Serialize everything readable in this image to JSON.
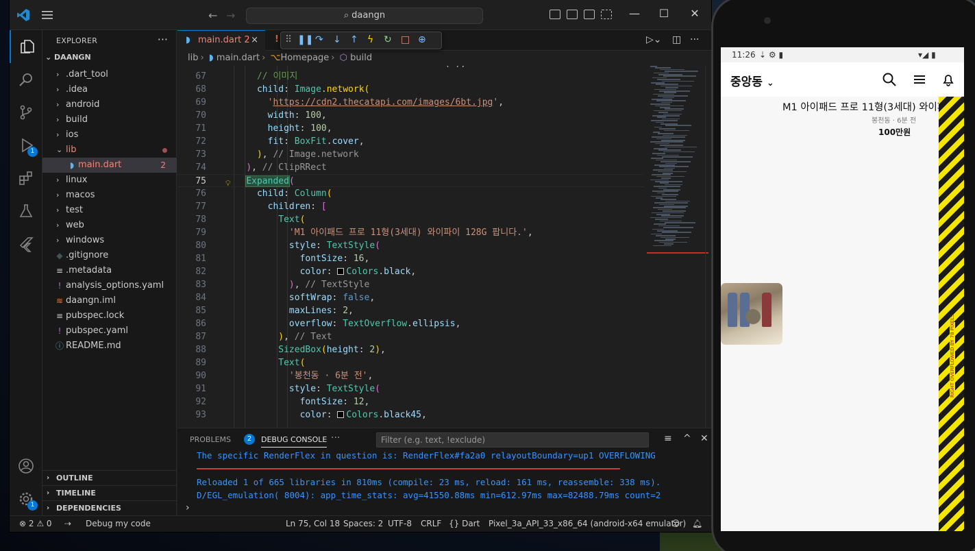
{
  "vscode": {
    "search": "daangn",
    "explorer": {
      "header": "EXPLORER",
      "root": "DAANGN",
      "items": [
        {
          "label": ".dart_tool",
          "type": "folder"
        },
        {
          "label": ".idea",
          "type": "folder"
        },
        {
          "label": "android",
          "type": "folder"
        },
        {
          "label": "build",
          "type": "folder"
        },
        {
          "label": "ios",
          "type": "folder"
        },
        {
          "label": "lib",
          "type": "folder-open"
        },
        {
          "label": "main.dart",
          "type": "file",
          "badge": "2"
        },
        {
          "label": "linux",
          "type": "folder"
        },
        {
          "label": "macos",
          "type": "folder"
        },
        {
          "label": "test",
          "type": "folder"
        },
        {
          "label": "web",
          "type": "folder"
        },
        {
          "label": "windows",
          "type": "folder"
        },
        {
          "label": ".gitignore",
          "type": "file"
        },
        {
          "label": ".metadata",
          "type": "file"
        },
        {
          "label": "analysis_options.yaml",
          "type": "file"
        },
        {
          "label": "daangn.iml",
          "type": "file"
        },
        {
          "label": "pubspec.lock",
          "type": "file"
        },
        {
          "label": "pubspec.yaml",
          "type": "file"
        },
        {
          "label": "README.md",
          "type": "file"
        }
      ],
      "sections": [
        "OUTLINE",
        "TIMELINE",
        "DEPENDENCIES"
      ]
    },
    "activity_badges": {
      "debug": "1",
      "settings": "1"
    },
    "tab": {
      "label": "main.dart",
      "count": "2",
      "close": "×"
    },
    "breadcrumb": {
      "lib": "lib",
      "file": "main.dart",
      "cls": "Homepage",
      "method": "build"
    },
    "code_first_line": 67,
    "panel": {
      "problems": "PROBLEMS",
      "problems_count": "2",
      "debug_console": "DEBUG CONSOLE",
      "more": "···",
      "filter_placeholder": "Filter (e.g. text, !exclude)",
      "lines": [
        "The specific RenderFlex in question is: RenderFlex#fa2a0 relayoutBoundary=up1 OVERFLOWING",
        "Reloaded 1 of 665 libraries in 810ms (compile: 23 ms, reload: 161 ms, reassemble: 338 ms).",
        "D/EGL_emulation( 8004): app_time_stats: avg=41550.88ms min=612.97ms max=82488.79ms count=2"
      ]
    },
    "status": {
      "errors": "⊗ 2 ⚠ 0",
      "debug": "Debug my code",
      "position": "Ln 75, Col 18",
      "spaces": "Spaces: 2",
      "encoding": "UTF-8",
      "eol": "CRLF",
      "language": "{} Dart",
      "device": "Pixel_3a_API_33_x86_64 (android-x64 emulator)"
    }
  },
  "phone": {
    "time": "11:26",
    "location": "중앙동",
    "product": {
      "title": "M1 아이패드 프로 11형(3세대) 와이파이 128G 팝니다.",
      "meta": "봉천동 · 6분 전",
      "price": "100만원"
    },
    "overflow_text": "RIGHT OVERFLOWED BY 78 PIXELS"
  },
  "colors": {
    "accent": "#0078d4",
    "error": "#f88070",
    "console": "#3794ff",
    "overflow_stripe": "#f5e600"
  }
}
